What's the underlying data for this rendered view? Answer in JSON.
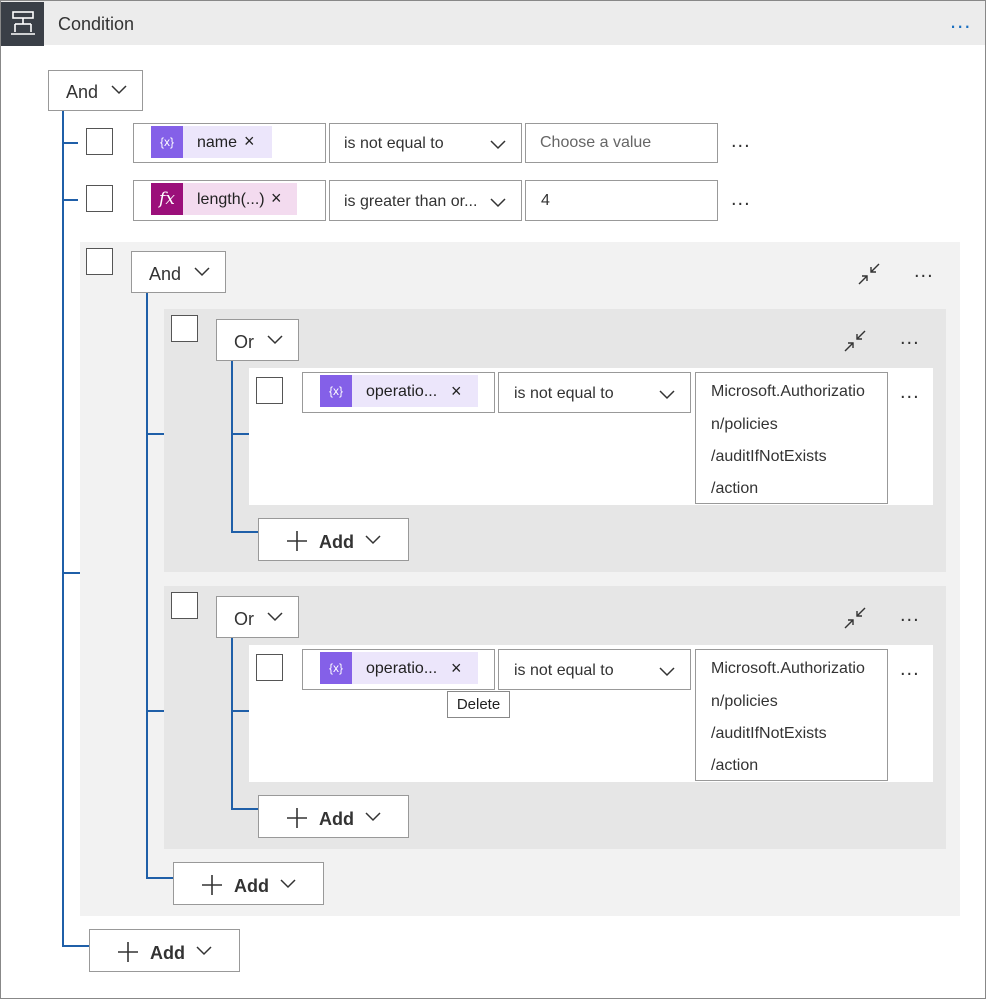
{
  "header": {
    "title": "Condition",
    "more": "..."
  },
  "root_group": {
    "operator": "And",
    "add_label": "Add"
  },
  "rows": [
    {
      "token": "name",
      "operator": "is not equal to",
      "value_placeholder": "Choose a value",
      "more": "..."
    },
    {
      "token": "length(...)",
      "operator": "is greater than or...",
      "value": "4",
      "more": "..."
    }
  ],
  "nested_group": {
    "operator": "And",
    "more": "...",
    "add_label": "Add"
  },
  "or_groups": [
    {
      "operator": "Or",
      "more": "...",
      "add_label": "Add",
      "row": {
        "token": "operatio...",
        "operator": "is not equal to",
        "value_lines": [
          "Microsoft.Authorizatio",
          "n/policies",
          "/auditIfNotExists",
          "/action"
        ],
        "more": "..."
      }
    },
    {
      "operator": "Or",
      "more": "...",
      "add_label": "Add",
      "row": {
        "token": "operatio...",
        "operator": "is not equal to",
        "value_lines": [
          "Microsoft.Authorizatio",
          "n/policies",
          "/auditIfNotExists",
          "/action"
        ],
        "more": "..."
      }
    }
  ],
  "tooltip": "Delete",
  "icons": {
    "token": "{x}",
    "fx": "fx",
    "close": "×",
    "plus": "+"
  }
}
